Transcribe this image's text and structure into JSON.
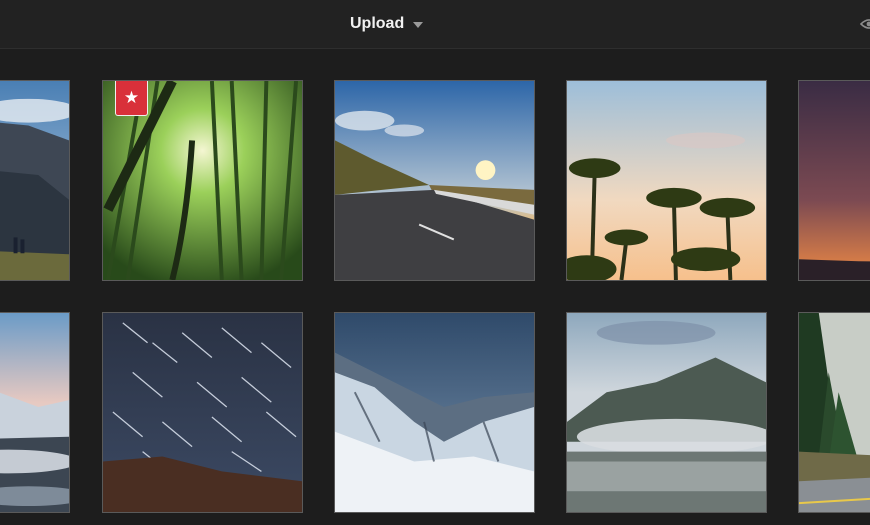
{
  "header": {
    "upload_label": "Upload",
    "caret_icon": "chevron-down-icon",
    "right_icon": "eye-icon"
  },
  "gallery": {
    "rows": [
      [
        "mountain-hikers-photo",
        "bamboo-forest-photo",
        "mountain-road-sunset-photo",
        "palm-trees-photo",
        "night-sky-dusk-photo"
      ],
      [
        "snowy-peaks-clouds-photo",
        "star-trails-photo",
        "snowy-mountain-range-photo",
        "misty-mountain-lake-photo",
        "forest-road-photo"
      ]
    ],
    "starred_tile": "bamboo-forest-photo",
    "badge_icon": "star-icon",
    "badge_symbol": "★"
  },
  "colors": {
    "background": "#1d1d1d",
    "topbar": "#222222",
    "badge": "#d9303a"
  }
}
